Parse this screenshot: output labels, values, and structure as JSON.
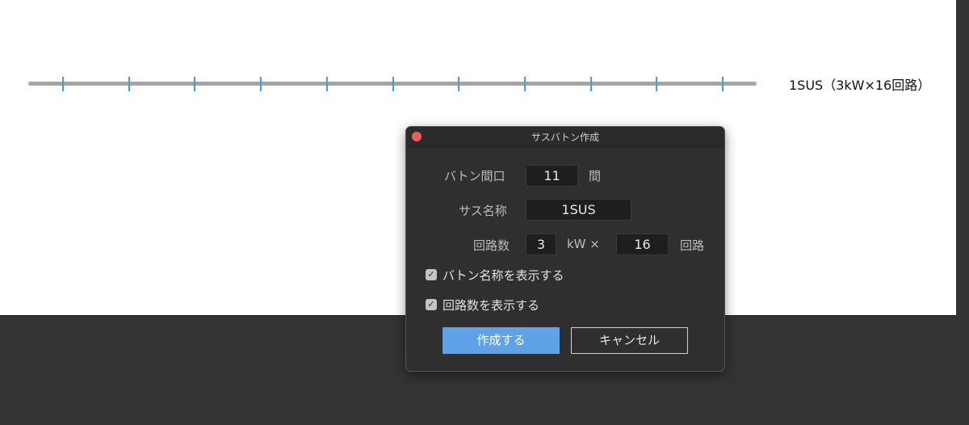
{
  "canvas": {
    "batten_label": "1SUS（3kW×16回路）",
    "tick_count": 11
  },
  "dialog": {
    "title": "サスバトン作成",
    "fields": {
      "batten_span_label": "バトン間口",
      "batten_span_value": "11",
      "batten_span_unit": "間",
      "sus_name_label": "サス名称",
      "sus_name_value": "1SUS",
      "circuits_label": "回路数",
      "kw_value": "3",
      "kw_unit": "kW ×",
      "circuit_count_value": "16",
      "circuit_unit": "回路"
    },
    "checkboxes": {
      "show_batten_name": {
        "label": "バトン名称を表示する",
        "checked": true
      },
      "show_circuit_count": {
        "label": "回路数を表示する",
        "checked": true
      }
    },
    "buttons": {
      "create": "作成する",
      "cancel": "キャンセル"
    }
  },
  "colors": {
    "tick": "#3ea2d6",
    "batten": "#a5a5a5",
    "primary_button": "#5ea3e8",
    "close_button": "#ec5f57",
    "dialog_bg": "#2f2f2f"
  },
  "icons": {
    "close": "close-icon",
    "check": "checkmark-icon"
  }
}
